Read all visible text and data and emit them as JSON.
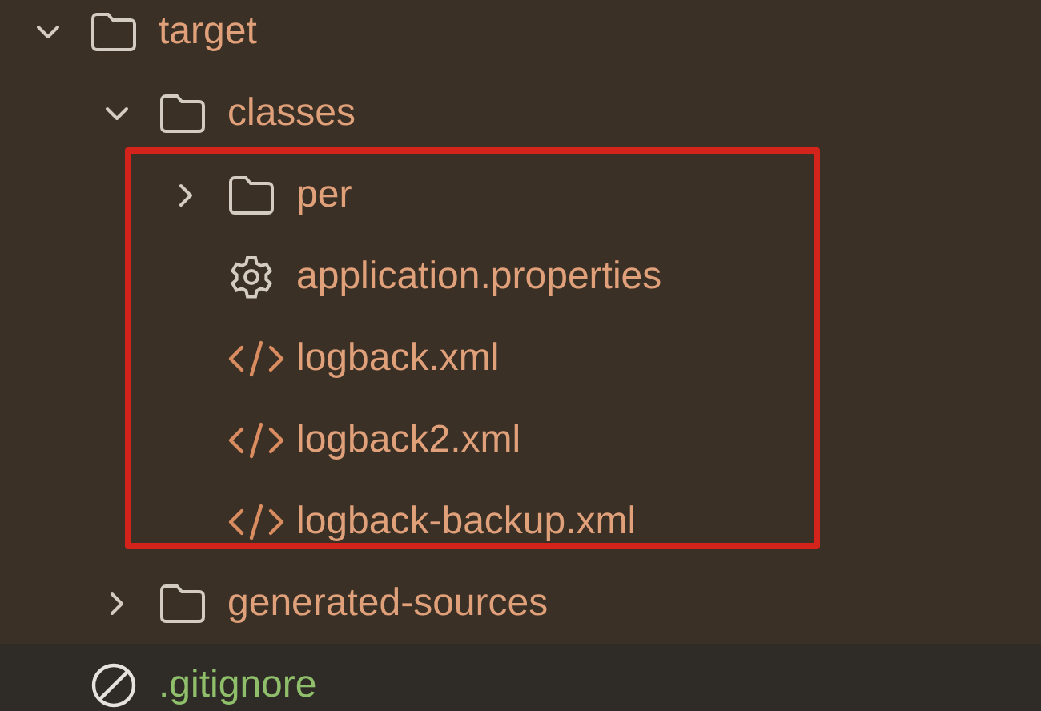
{
  "tree": [
    {
      "name": "target",
      "kind": "folder",
      "expanded": true,
      "selected": false,
      "children": [
        {
          "name": "classes",
          "kind": "folder",
          "expanded": true,
          "selected": false,
          "highlighted": true,
          "children": [
            {
              "name": "per",
              "kind": "folder",
              "expanded": false,
              "selected": false
            },
            {
              "name": "application.properties",
              "kind": "settings",
              "selected": false
            },
            {
              "name": "logback.xml",
              "kind": "code",
              "selected": false
            },
            {
              "name": "logback2.xml",
              "kind": "code",
              "selected": false
            },
            {
              "name": "logback-backup.xml",
              "kind": "code",
              "selected": false
            }
          ]
        },
        {
          "name": "generated-sources",
          "kind": "folder",
          "expanded": false,
          "selected": false
        }
      ]
    },
    {
      "name": ".gitignore",
      "kind": "ignored",
      "selected": true
    }
  ]
}
